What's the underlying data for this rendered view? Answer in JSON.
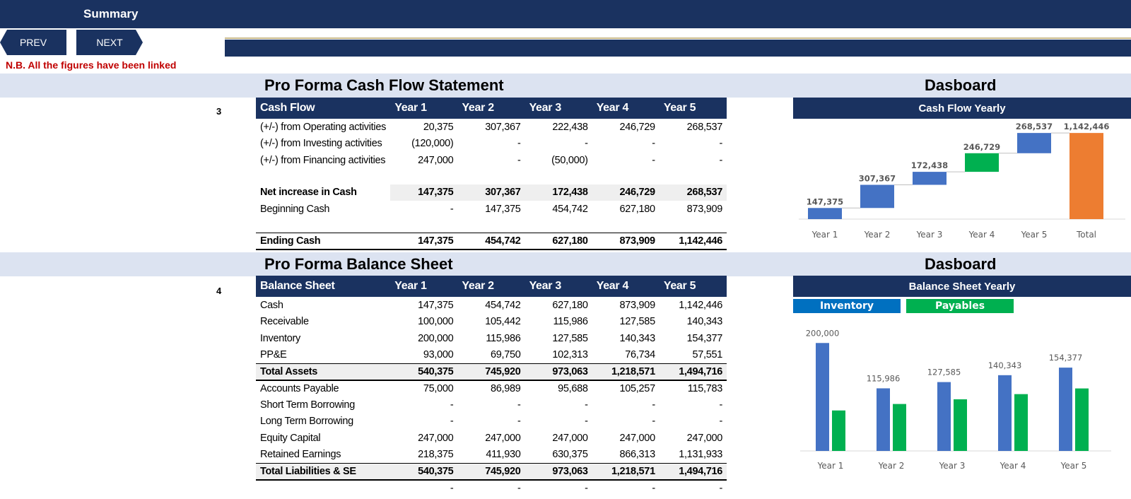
{
  "header": {
    "title": "Summary",
    "prev_label": "PREV",
    "next_label": "NEXT"
  },
  "note": "N.B. All the figures have been linked",
  "cashflow": {
    "section_number": "3",
    "title": "Pro Forma Cash Flow Statement",
    "columns": [
      "Cash Flow",
      "Year 1",
      "Year 2",
      "Year 3",
      "Year 4",
      "Year 5"
    ],
    "rows": [
      {
        "label": "(+/-) from Operating activities",
        "values": [
          "20,375",
          "307,367",
          "222,438",
          "246,729",
          "268,537"
        ]
      },
      {
        "label": "(+/-) from Investing activities",
        "values": [
          "(120,000)",
          "-",
          "-",
          "-",
          "-"
        ]
      },
      {
        "label": "(+/-) from Financing activities",
        "values": [
          "247,000",
          "-",
          "(50,000)",
          "-",
          "-"
        ]
      },
      {
        "label": "Net increase in Cash",
        "values": [
          "147,375",
          "307,367",
          "172,438",
          "246,729",
          "268,537"
        ]
      },
      {
        "label": "Beginning Cash",
        "values": [
          "-",
          "147,375",
          "454,742",
          "627,180",
          "873,909"
        ]
      },
      {
        "label": "Ending Cash",
        "values": [
          "147,375",
          "454,742",
          "627,180",
          "873,909",
          "1,142,446"
        ]
      }
    ]
  },
  "balance": {
    "section_number": "4",
    "title": "Pro Forma Balance Sheet",
    "columns": [
      "Balance Sheet",
      "Year 1",
      "Year 2",
      "Year 3",
      "Year 4",
      "Year 5"
    ],
    "rows": [
      {
        "label": "Cash",
        "values": [
          "147,375",
          "454,742",
          "627,180",
          "873,909",
          "1,142,446"
        ]
      },
      {
        "label": "Receivable",
        "values": [
          "100,000",
          "105,442",
          "115,986",
          "127,585",
          "140,343"
        ]
      },
      {
        "label": "Inventory",
        "values": [
          "200,000",
          "115,986",
          "127,585",
          "140,343",
          "154,377"
        ]
      },
      {
        "label": "PP&E",
        "values": [
          "93,000",
          "69,750",
          "102,313",
          "76,734",
          "57,551"
        ]
      },
      {
        "label": "Total Assets",
        "values": [
          "540,375",
          "745,920",
          "973,063",
          "1,218,571",
          "1,494,716"
        ]
      },
      {
        "label": "Accounts Payable",
        "values": [
          "75,000",
          "86,989",
          "95,688",
          "105,257",
          "115,783"
        ]
      },
      {
        "label": "Short Term Borrowing",
        "values": [
          "-",
          "-",
          "-",
          "-",
          "-"
        ]
      },
      {
        "label": "Long Term Borrowing",
        "values": [
          "-",
          "-",
          "-",
          "-",
          "-"
        ]
      },
      {
        "label": "Equity Capital",
        "values": [
          "247,000",
          "247,000",
          "247,000",
          "247,000",
          "247,000"
        ]
      },
      {
        "label": "Retained Earnings",
        "values": [
          "218,375",
          "411,930",
          "630,375",
          "866,313",
          "1,131,933"
        ]
      },
      {
        "label": "Total Liabilities & SE",
        "values": [
          "540,375",
          "745,920",
          "973,063",
          "1,218,571",
          "1,494,716"
        ]
      }
    ],
    "trailing": [
      "-",
      "-",
      "-",
      "-",
      "-"
    ]
  },
  "dashboards": [
    {
      "title": "Dasboard",
      "chart_title": "Cash Flow Yearly"
    },
    {
      "title": "Dasboard",
      "chart_title": "Balance Sheet Yearly"
    }
  ],
  "legend": {
    "inventory": "Inventory",
    "payables": "Payables"
  },
  "colors": {
    "navy": "#1a3260",
    "band": "#dce3f1",
    "blue": "#4472c4",
    "green": "#00b050",
    "orange": "#ed7d31",
    "red_note": "#c00000",
    "legend_blue": "#0070c0"
  },
  "chart_data": [
    {
      "type": "waterfall",
      "title": "Cash Flow Yearly",
      "categories": [
        "Year 1",
        "Year 2",
        "Year 3",
        "Year 4",
        "Year 5",
        "Total"
      ],
      "values": [
        147375,
        307367,
        172438,
        246729,
        268537,
        1142446
      ],
      "labels": [
        "147,375",
        "307,367",
        "172,438",
        "246,729",
        "268,537",
        "1,142,446"
      ],
      "bar_colors": [
        "#4472c4",
        "#4472c4",
        "#4472c4",
        "#00b050",
        "#4472c4",
        "#ed7d31"
      ],
      "ylim": [
        0,
        1200000
      ]
    },
    {
      "type": "bar",
      "title": "Balance Sheet Yearly",
      "categories": [
        "Year 1",
        "Year 2",
        "Year 3",
        "Year 4",
        "Year 5"
      ],
      "series": [
        {
          "name": "Inventory",
          "values": [
            200000,
            115986,
            127585,
            140343,
            154377
          ],
          "labels": [
            "200,000",
            "115,986",
            "127,585",
            "140,343",
            "154,377"
          ],
          "color": "#4472c4"
        },
        {
          "name": "Payables",
          "values": [
            75000,
            86989,
            95688,
            105257,
            115783
          ],
          "color": "#00b050"
        }
      ],
      "ylim": [
        0,
        220000
      ]
    }
  ]
}
